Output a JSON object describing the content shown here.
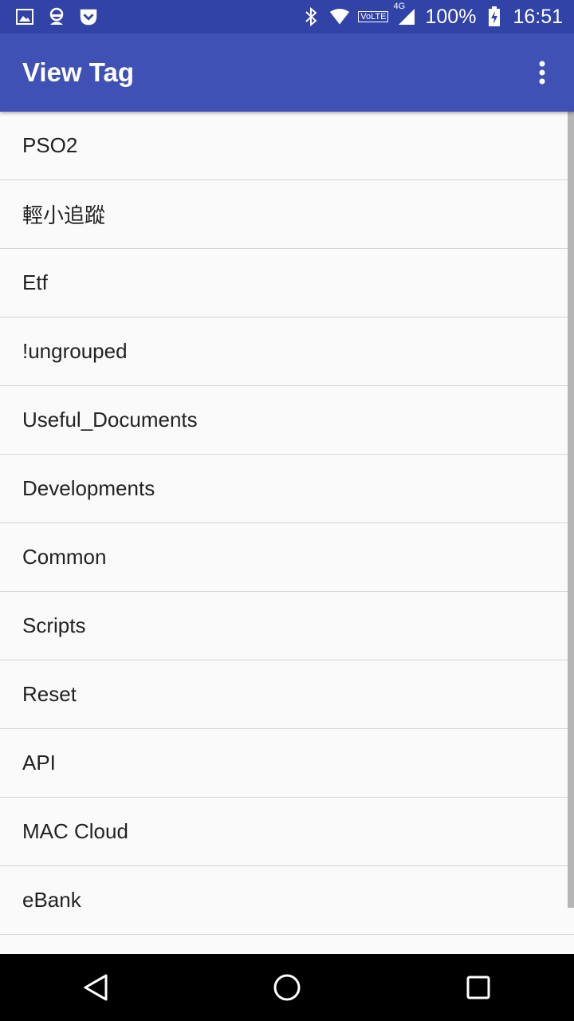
{
  "status_bar": {
    "battery": "100%",
    "time": "16:51",
    "network_label": "4G",
    "volte_label": "VoLTE",
    "icons": [
      "gallery-icon",
      "account-icon",
      "pocket-icon",
      "bluetooth-icon",
      "wifi-icon",
      "signal-icon",
      "battery-charging-icon"
    ]
  },
  "app_bar": {
    "title": "View Tag",
    "menu_icon": "more-vert-icon",
    "color": "#3f51b5",
    "status_color": "#3143a6"
  },
  "tags": [
    {
      "label": "PSO2"
    },
    {
      "label": "輕小追蹤"
    },
    {
      "label": "Etf"
    },
    {
      "label": "!ungrouped"
    },
    {
      "label": "Useful_Documents"
    },
    {
      "label": "Developments"
    },
    {
      "label": "Common"
    },
    {
      "label": "Scripts"
    },
    {
      "label": "Reset"
    },
    {
      "label": "API"
    },
    {
      "label": "MAC Cloud"
    },
    {
      "label": "eBank"
    }
  ],
  "nav_bar": {
    "back": "back-icon",
    "home": "home-icon",
    "recents": "recents-icon"
  }
}
